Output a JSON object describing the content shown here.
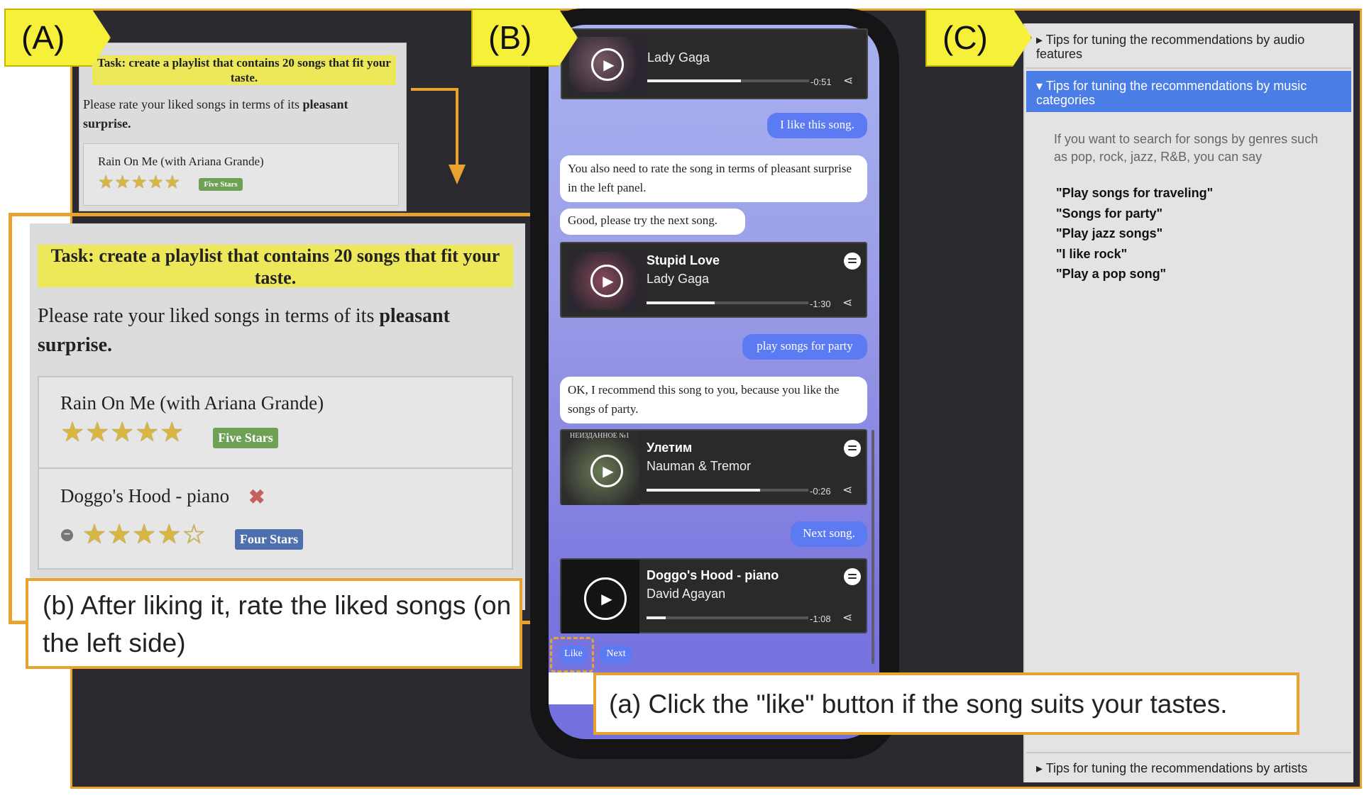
{
  "tags": {
    "a": "(A)",
    "b": "(B)",
    "c": "(C)"
  },
  "panel_a_small": {
    "task": "Task: create a playlist that contains 20 songs that fit your taste.",
    "instruction_prefix": "Please rate your liked songs in terms of its ",
    "instruction_bold": "pleasant surprise.",
    "song": "Rain On Me (with Ariana Grande)",
    "stars": "★★★★★",
    "badge": "Five Stars"
  },
  "panel_a_large": {
    "task": "Task: create a playlist that contains 20 songs that fit your taste.",
    "instruction_prefix": "Please rate your liked songs in terms of its ",
    "instruction_bold": "pleasant surprise.",
    "songs": [
      {
        "title": "Rain On Me (with Ariana Grande)",
        "stars": "★★★★★",
        "rating": 5,
        "badge": "Five Stars"
      },
      {
        "title": "Doggo's Hood - piano",
        "remove": "✖",
        "clear": "−",
        "stars": "★★★★☆",
        "rating": 4,
        "badge": "Four Stars"
      }
    ]
  },
  "captions": {
    "b": "(b) After liking it, rate the liked songs (on the left side)",
    "a": "(a) Click the \"like\" button if the song suits your tastes."
  },
  "chat": {
    "players": [
      {
        "title": "",
        "artist": "Lady Gaga",
        "time": "-0:51",
        "progress": 0.58
      },
      {
        "title": "Stupid Love",
        "artist": "Lady Gaga",
        "time": "-1:30",
        "progress": 0.42
      },
      {
        "title": "Улетим",
        "artist": "Nauman & Tremor",
        "time": "-0:26",
        "progress": 0.7,
        "art_label": "НЕИЗДАННОЕ №1"
      },
      {
        "title": "Doggo's Hood - piano",
        "artist": "David Agayan",
        "time": "-1:08",
        "progress": 0.12
      }
    ],
    "messages": [
      {
        "from": "user",
        "text": "I like this song."
      },
      {
        "from": "bot",
        "text": "You also need to rate the song in terms of pleasant surprise in the left panel."
      },
      {
        "from": "bot",
        "text": "Good, please try the next song."
      },
      {
        "from": "user",
        "text": "play songs for party"
      },
      {
        "from": "bot",
        "text": "OK, I recommend this song to you, because you like the songs of party."
      },
      {
        "from": "user",
        "text": "Next song."
      }
    ],
    "buttons": {
      "like": "Like",
      "next": "Next"
    }
  },
  "panel_c": {
    "accordions": [
      {
        "label": "Tips for tuning the recommendations by audio features",
        "expanded": false
      },
      {
        "label": "Tips for tuning the recommendations by music categories",
        "expanded": true
      },
      {
        "label": "Tips for tuning the recommendations by artists",
        "expanded": false
      }
    ],
    "body": "If you want to search for songs by genres such as pop, rock, jazz, R&B, you can say",
    "examples": [
      "\"Play songs for traveling\"",
      "\"Songs for party\"",
      "\"Play jazz songs\"",
      "\"I like rock\"",
      "\"Play a pop song\""
    ]
  },
  "colors": {
    "accent_orange": "#e8a32e",
    "tag_yellow": "#f7f03a",
    "chat_blue": "#5c7bf2",
    "accordion_blue": "#4a7de6"
  }
}
